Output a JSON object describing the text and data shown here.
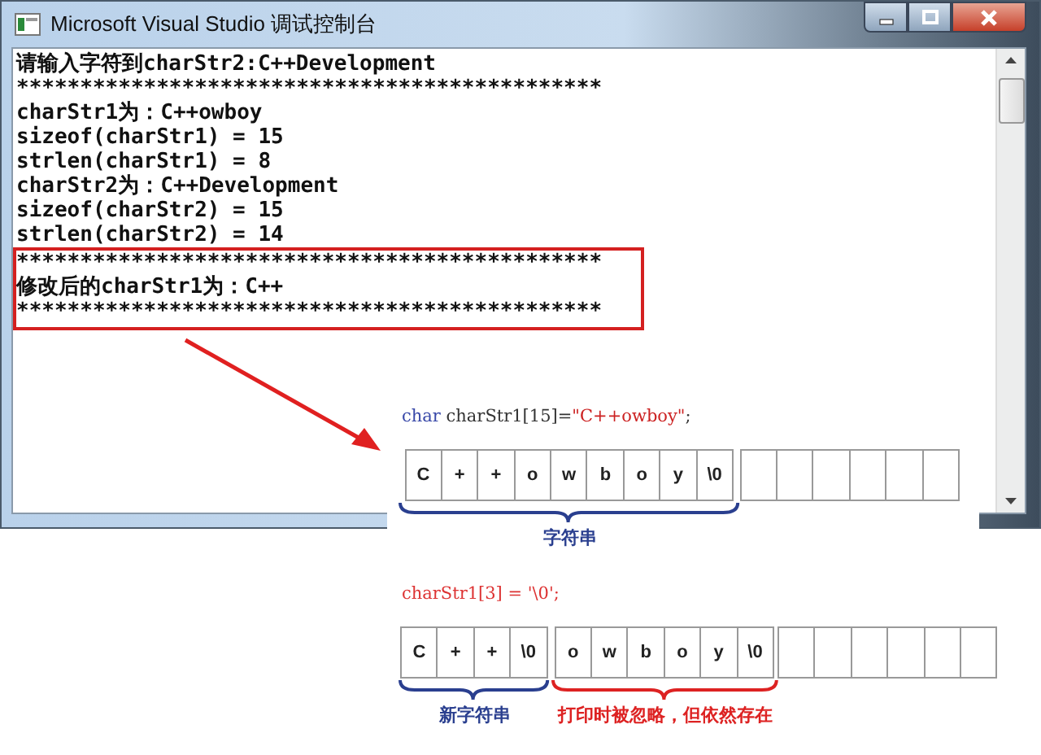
{
  "window": {
    "title": "Microsoft Visual Studio 调试控制台"
  },
  "console": {
    "lines": [
      {
        "text": "请输入字符到charStr2:C++Development"
      },
      {
        "text": "**********************************************"
      },
      {
        "text": "charStr1为：C++owboy"
      },
      {
        "text": "sizeof(charStr1) = 15"
      },
      {
        "text": "strlen(charStr1) = 8"
      },
      {
        "text": "charStr2为：C++Development"
      },
      {
        "text": "sizeof(charStr2) = 15"
      },
      {
        "text": "strlen(charStr2) = 14"
      }
    ],
    "highlighted_lines": [
      {
        "text": "**********************************************"
      },
      {
        "text": "修改后的charStr1为：C++"
      },
      {
        "text": "**********************************************"
      }
    ]
  },
  "diagrams": [
    {
      "code": [
        {
          "text": "char",
          "color": "#3848a8"
        },
        {
          "text": " charStr1[15]=",
          "color": "#333333"
        },
        {
          "text": "\"C++owboy\"",
          "color": "#cc2222"
        },
        {
          "text": ";",
          "color": "#333333"
        }
      ],
      "groups": [
        {
          "brace": {
            "label": "字符串",
            "color": "#2a3f8f"
          },
          "cells": [
            {
              "kind": "char",
              "text": "C"
            },
            {
              "kind": "char",
              "text": "+"
            },
            {
              "kind": "char",
              "text": "+"
            },
            {
              "kind": "char",
              "text": "o"
            },
            {
              "kind": "char",
              "text": "w"
            },
            {
              "kind": "char",
              "text": "b"
            },
            {
              "kind": "char",
              "text": "o"
            },
            {
              "kind": "char",
              "text": "y"
            },
            {
              "kind": "char",
              "text": "\\0"
            }
          ]
        },
        {
          "cells": [
            {
              "kind": "empty"
            },
            {
              "kind": "empty"
            },
            {
              "kind": "empty"
            },
            {
              "kind": "empty"
            },
            {
              "kind": "empty"
            },
            {
              "kind": "empty"
            }
          ]
        }
      ]
    },
    {
      "code": [
        {
          "text": "charStr1[3] = '\\0';",
          "color": "#dd3333"
        }
      ],
      "groups": [
        {
          "brace": {
            "label": "新字符串",
            "color": "#2a3f8f"
          },
          "cells": [
            {
              "kind": "char",
              "text": "C"
            },
            {
              "kind": "char",
              "text": "+"
            },
            {
              "kind": "char",
              "text": "+"
            },
            {
              "kind": "char",
              "text": "\\0"
            }
          ]
        },
        {
          "brace": {
            "label": "打印时被忽略，但依然存在",
            "color": "#dd2222"
          },
          "cells": [
            {
              "kind": "char",
              "text": "o"
            },
            {
              "kind": "char",
              "text": "w"
            },
            {
              "kind": "char",
              "text": "b"
            },
            {
              "kind": "char",
              "text": "o"
            },
            {
              "kind": "char",
              "text": "y"
            },
            {
              "kind": "char",
              "text": "\\0"
            }
          ]
        },
        {
          "cells": [
            {
              "kind": "empty"
            },
            {
              "kind": "empty"
            },
            {
              "kind": "empty"
            },
            {
              "kind": "empty"
            },
            {
              "kind": "empty"
            },
            {
              "kind": "empty"
            }
          ]
        }
      ]
    }
  ]
}
